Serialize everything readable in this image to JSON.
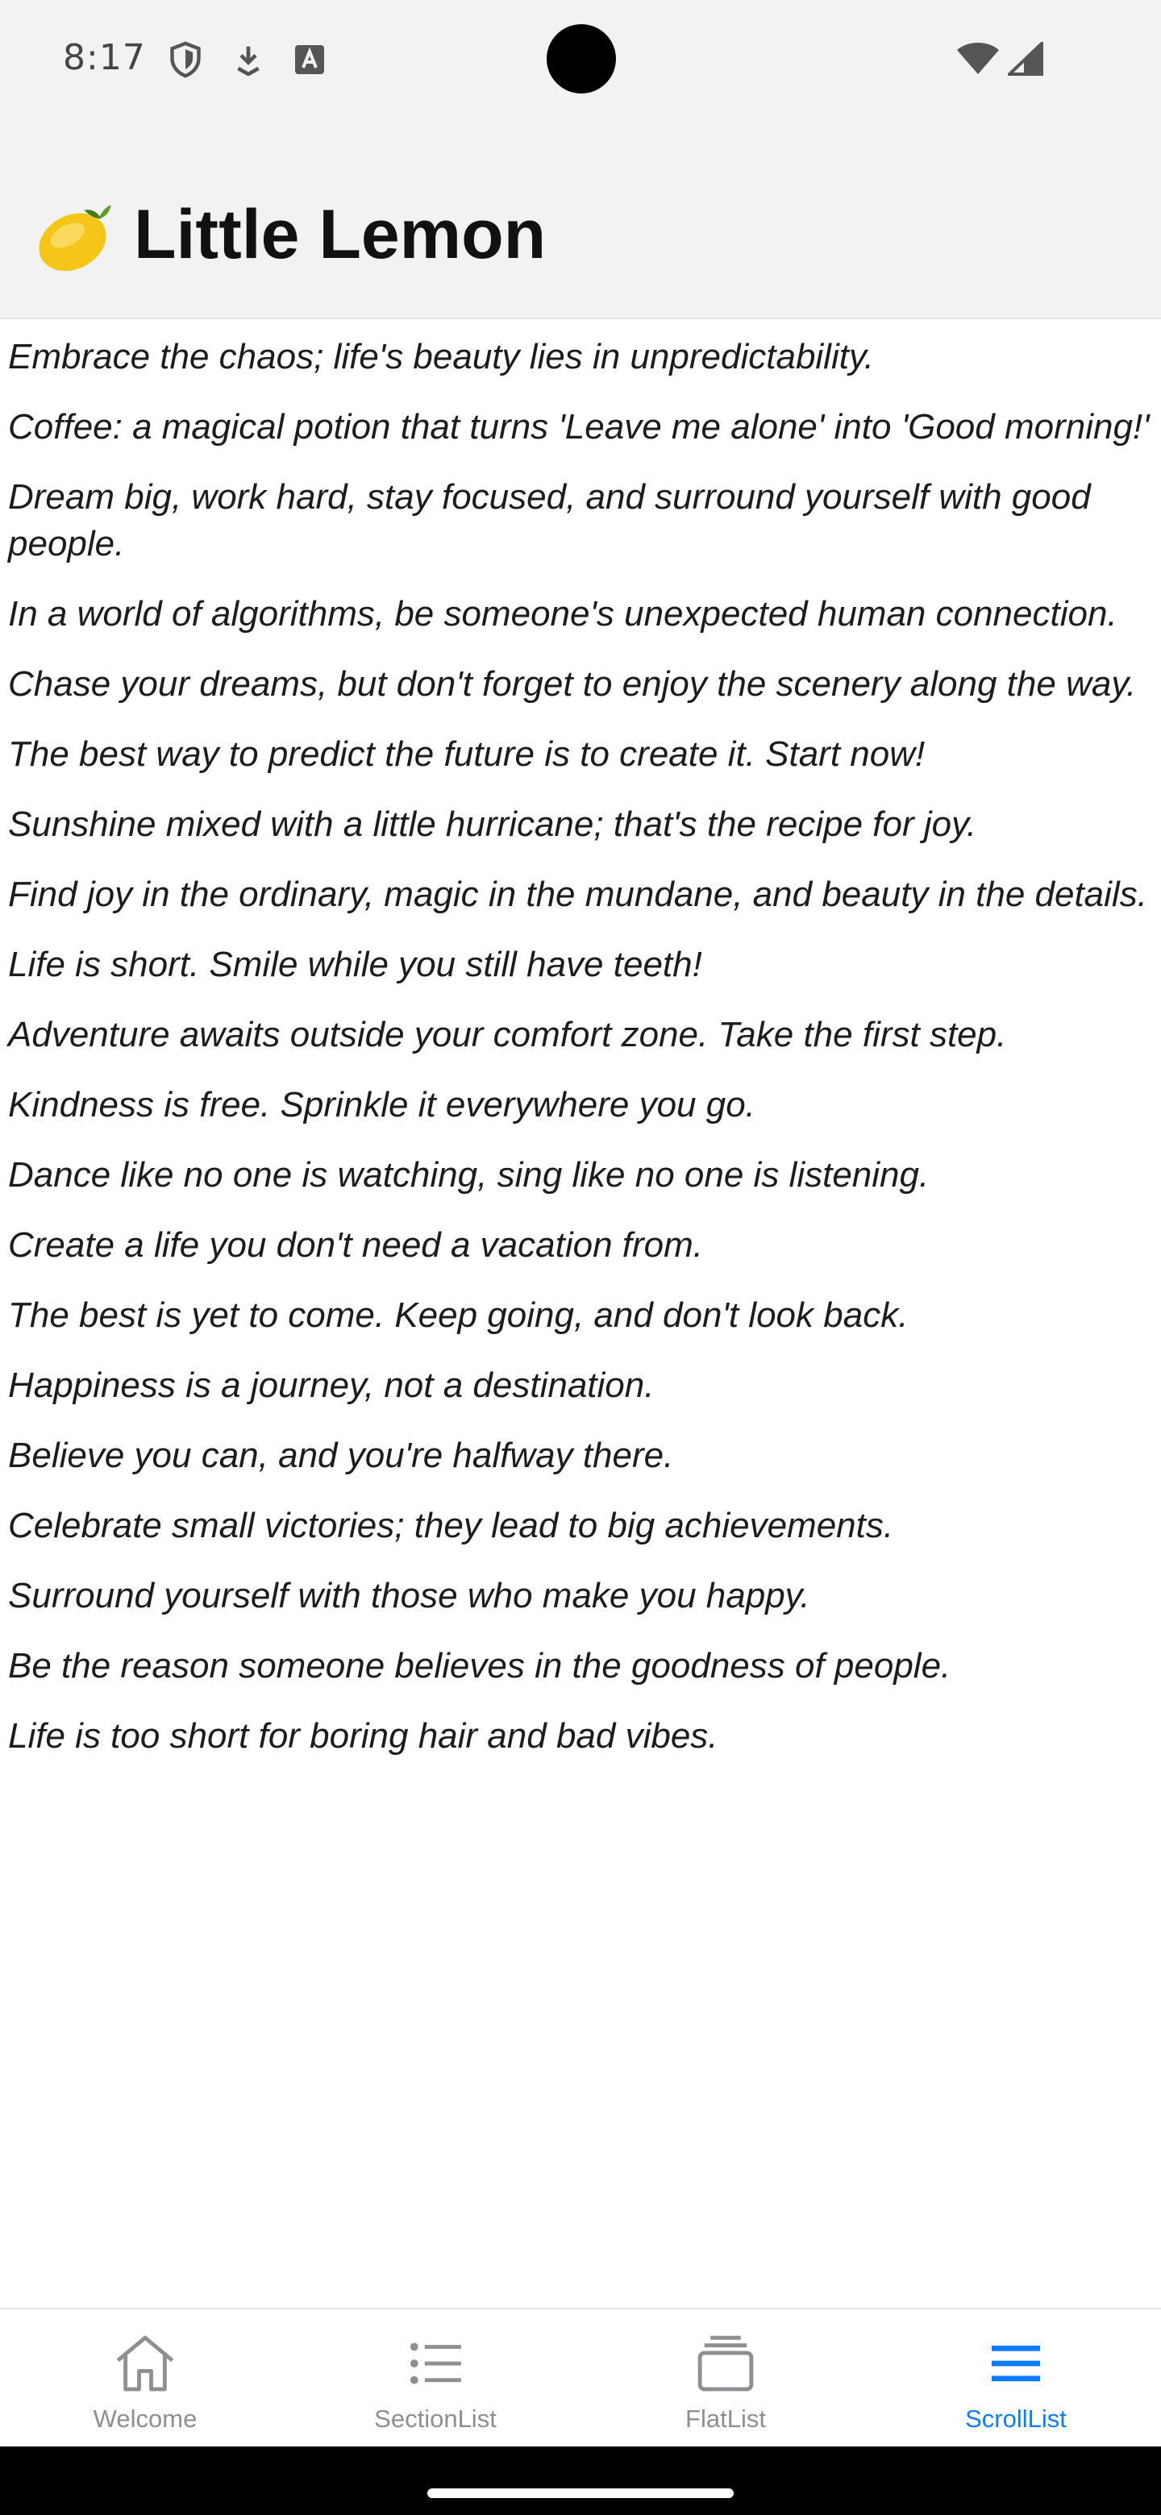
{
  "status_bar": {
    "time": "8:17",
    "icons": [
      "shield-icon",
      "download-icon",
      "keyboard-a-icon",
      "wifi-icon",
      "cellular-signal-icon"
    ]
  },
  "header": {
    "emoji_icon": "lemon-emoji",
    "title": "Little Lemon"
  },
  "quotes": [
    "Embrace the chaos; life's beauty lies in unpredictability.",
    "Coffee: a magical potion that turns 'Leave me alone' into 'Good morning!'",
    "Dream big, work hard, stay focused, and surround yourself with good people.",
    "In a world of algorithms, be someone's unexpected human connection.",
    "Chase your dreams, but don't forget to enjoy the scenery along the way.",
    "The best way to predict the future is to create it. Start now!",
    "Sunshine mixed with a little hurricane; that's the recipe for joy.",
    "Find joy in the ordinary, magic in the mundane, and beauty in the details.",
    "Life is short. Smile while you still have teeth!",
    "Adventure awaits outside your comfort zone. Take the first step.",
    "Kindness is free. Sprinkle it everywhere you go.",
    "Dance like no one is watching, sing like no one is listening.",
    "Create a life you don't need a vacation from.",
    "The best is yet to come. Keep going, and don't look back.",
    "Happiness is a journey, not a destination.",
    "Believe you can, and you're halfway there.",
    "Celebrate small victories; they lead to big achievements.",
    "Surround yourself with those who make you happy.",
    "Be the reason someone believes in the goodness of people.",
    "Life is too short for boring hair and bad vibes."
  ],
  "tabs": [
    {
      "label": "Welcome",
      "icon": "home-icon",
      "active": false
    },
    {
      "label": "SectionList",
      "icon": "list-icon",
      "active": false
    },
    {
      "label": "FlatList",
      "icon": "stack-icon",
      "active": false
    },
    {
      "label": "ScrollList",
      "icon": "menu-icon",
      "active": true
    }
  ],
  "colors": {
    "header_bg": "#f2f2f2",
    "active_tab": "#0a7cff",
    "inactive_tab": "#8e8e93"
  }
}
